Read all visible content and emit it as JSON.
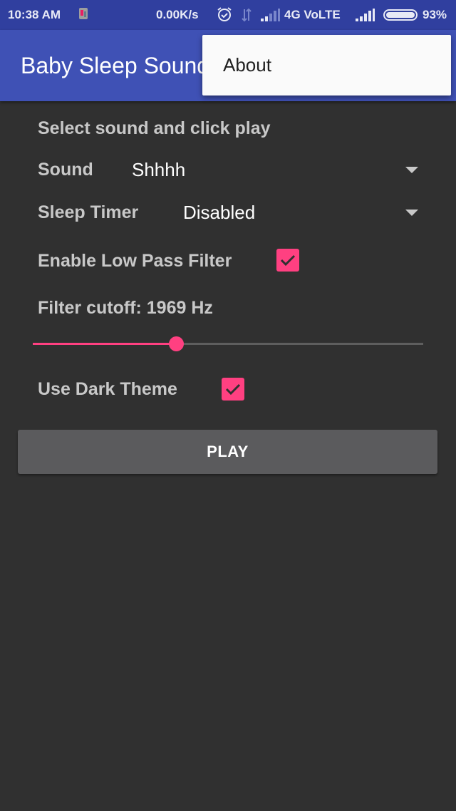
{
  "status_bar": {
    "time": "10:38 AM",
    "net_speed": "0.00K/s",
    "network_label": "4G VoLTE",
    "battery_percent": "93%",
    "battery_level": 0.93
  },
  "app_bar": {
    "title": "Baby Sleep Sounds",
    "colors": {
      "primary": "#3f51b5",
      "primary_dark": "#303f9f"
    }
  },
  "overflow_menu": {
    "items": [
      {
        "label": "About"
      }
    ]
  },
  "main": {
    "instruction": "Select sound and click play",
    "sound": {
      "label": "Sound",
      "selected": "Shhhh"
    },
    "sleep_timer": {
      "label": "Sleep Timer",
      "selected": "Disabled"
    },
    "low_pass_filter": {
      "label": "Enable Low Pass Filter",
      "checked": true
    },
    "filter_cutoff": {
      "label": "Filter cutoff: 1969 Hz",
      "slider_fraction": 0.367
    },
    "dark_theme": {
      "label": "Use Dark Theme",
      "checked": true
    },
    "play_button": "PLAY",
    "accent_color": "#ff4081"
  }
}
